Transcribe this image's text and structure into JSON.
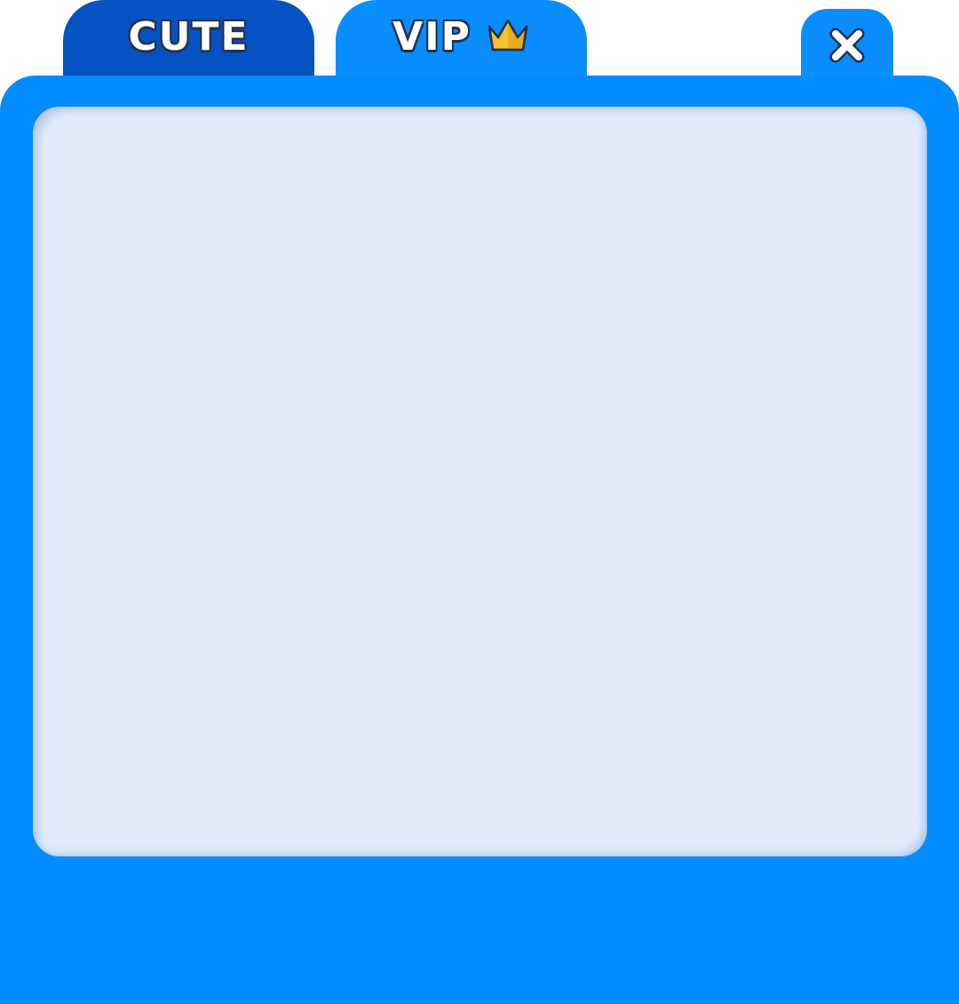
{
  "tabs": [
    {
      "label": "CUTE",
      "selected": false
    },
    {
      "label": "VIP",
      "selected": true,
      "icon": "crown-icon"
    }
  ],
  "close_button": {
    "icon": "close-icon"
  },
  "colors": {
    "tab_inactive": "#0552c2",
    "tab_active": "#0a8dff",
    "panel": "#038cff",
    "content_area": "#e1ecfd",
    "crown": "#f5c233",
    "text_outline": "#26304a"
  }
}
